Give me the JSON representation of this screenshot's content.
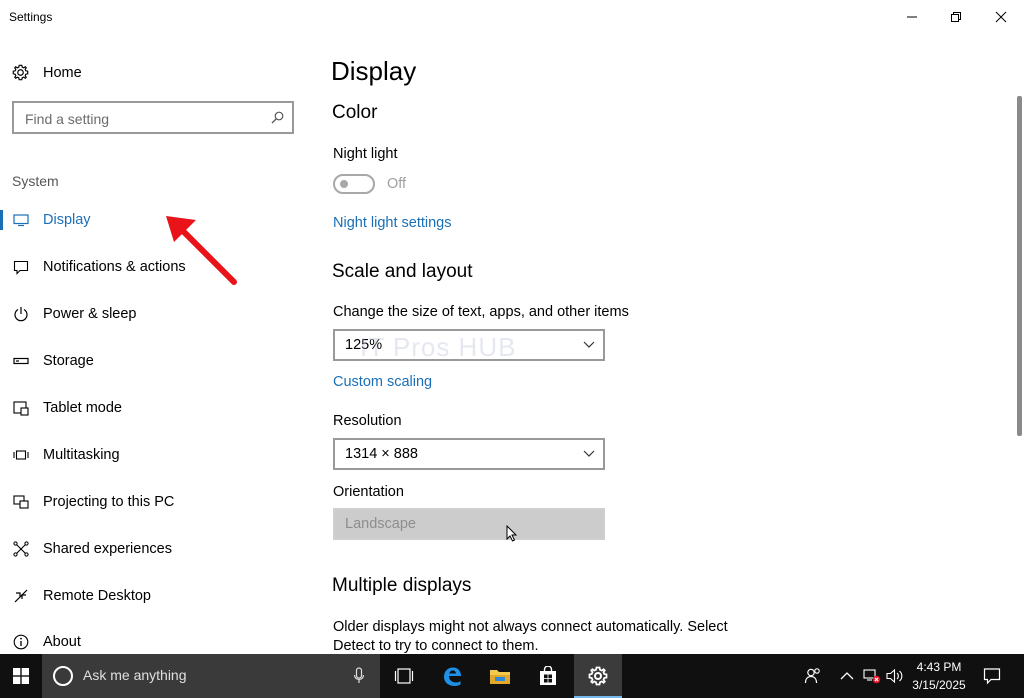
{
  "window": {
    "title": "Settings"
  },
  "sidebar": {
    "home_label": "Home",
    "search_placeholder": "Find a setting",
    "section_label": "System",
    "items": [
      {
        "label": "Display",
        "icon": "monitor-icon",
        "active": true
      },
      {
        "label": "Notifications & actions",
        "icon": "message-icon"
      },
      {
        "label": "Power & sleep",
        "icon": "power-icon"
      },
      {
        "label": "Storage",
        "icon": "storage-icon"
      },
      {
        "label": "Tablet mode",
        "icon": "tablet-mode-icon"
      },
      {
        "label": "Multitasking",
        "icon": "multitasking-icon"
      },
      {
        "label": "Projecting to this PC",
        "icon": "projecting-icon"
      },
      {
        "label": "Shared experiences",
        "icon": "shared-experiences-icon"
      },
      {
        "label": "Remote Desktop",
        "icon": "remote-desktop-icon"
      },
      {
        "label": "About",
        "icon": "info-icon"
      }
    ]
  },
  "main": {
    "title": "Display",
    "color_heading": "Color",
    "night_light_label": "Night light",
    "night_light_state": "Off",
    "night_light_settings_link": "Night light settings",
    "scale_heading": "Scale and layout",
    "scale_label": "Change the size of text, apps, and other items",
    "scale_value": "125%",
    "custom_scaling_link": "Custom scaling",
    "resolution_label": "Resolution",
    "resolution_value": "1314 × 888",
    "orientation_label": "Orientation",
    "orientation_value": "Landscape",
    "multiple_heading": "Multiple displays",
    "multiple_text": "Older displays might not always connect automatically. Select Detect to try to connect to them."
  },
  "watermark": "IT Pros HUB",
  "taskbar": {
    "search_placeholder": "Ask me anything",
    "time": "4:43 PM",
    "date": "3/15/2025"
  },
  "colors": {
    "accent": "#1a6fb7",
    "taskbar": "#101010",
    "annotation": "#e8141a"
  }
}
